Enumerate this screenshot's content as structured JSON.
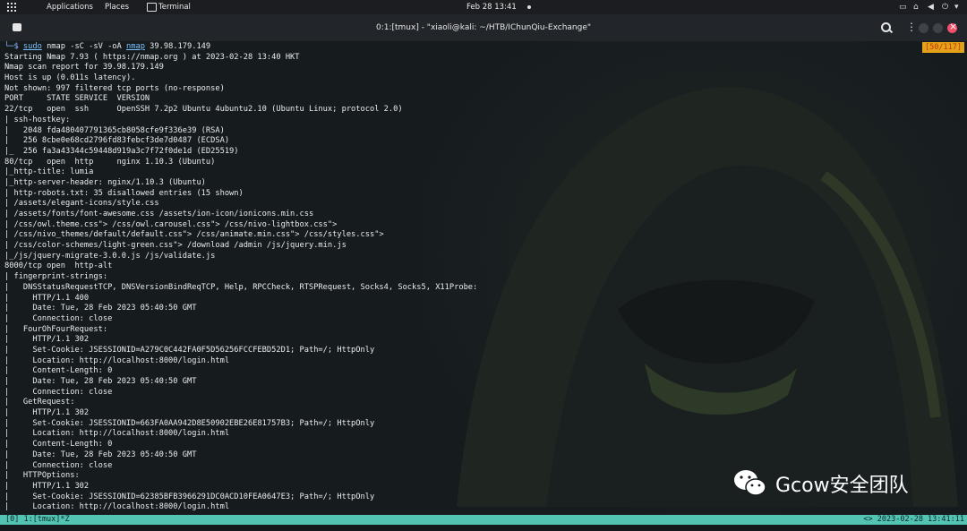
{
  "topbar": {
    "applications": "Applications",
    "places": "Places",
    "terminal": "Terminal",
    "clock": "Feb 28  13:41",
    "tray_icons": [
      "display-icon",
      "network-icon",
      "volume-icon",
      "power-icon"
    ]
  },
  "titlebar": {
    "title": "0:1:[tmux] - \"xiaoli@kali: ~/HTB/IChunQiu-Exchange\""
  },
  "terminal": {
    "counter": "[50/117]",
    "prompt": {
      "prefix": "└─$ ",
      "sudo": "sudo",
      "args": " nmap -sC -sV -oA ",
      "nmap": "nmap",
      "target": " 39.98.179.149"
    },
    "lines": [
      "Starting Nmap 7.93 ( https://nmap.org ) at 2023-02-28 13:40 HKT",
      "Nmap scan report for 39.98.179.149",
      "Host is up (0.011s latency).",
      "Not shown: 997 filtered tcp ports (no-response)",
      "PORT     STATE SERVICE  VERSION",
      "22/tcp   open  ssh      OpenSSH 7.2p2 Ubuntu 4ubuntu2.10 (Ubuntu Linux; protocol 2.0)",
      "| ssh-hostkey:",
      "|   2048 fda480407791365cb8058cfe9f336e39 (RSA)",
      "|   256 8cbe0e68cd2796fd83febcf3de7d0487 (ECDSA)",
      "|_  256 fa3a43344c59448d919a3c7f72f0de1d (ED25519)",
      "80/tcp   open  http     nginx 1.10.3 (Ubuntu)",
      "|_http-title: lumia",
      "|_http-server-header: nginx/1.10.3 (Ubuntu)",
      "| http-robots.txt: 35 disallowed entries (15 shown)",
      "| /assets/elegant-icons/style.css",
      "| /assets/fonts/font-awesome.css /assets/ion-icon/ionicons.min.css",
      "| /css/owl.theme.css\"> /css/owl.carousel.css\"> /css/nivo-lightbox.css\">",
      "| /css/nivo_themes/default/default.css\"> /css/animate.min.css\"> /css/styles.css\">",
      "| /css/color-schemes/light-green.css\"> /download /admin /js/jquery.min.js",
      "|_/js/jquery-migrate-3.0.0.js /js/validate.js",
      "8000/tcp open  http-alt",
      "| fingerprint-strings:",
      "|   DNSStatusRequestTCP, DNSVersionBindReqTCP, Help, RPCCheck, RTSPRequest, Socks4, Socks5, X11Probe:",
      "|     HTTP/1.1 400",
      "|     Date: Tue, 28 Feb 2023 05:40:50 GMT",
      "|     Connection: close",
      "|   FourOhFourRequest:",
      "|     HTTP/1.1 302",
      "|     Set-Cookie: JSESSIONID=A279C0C442FA0F5D56256FCCFEBD52D1; Path=/; HttpOnly",
      "|     Location: http://localhost:8000/login.html",
      "|     Content-Length: 0",
      "|     Date: Tue, 28 Feb 2023 05:40:50 GMT",
      "|     Connection: close",
      "|   GetRequest:",
      "|     HTTP/1.1 302",
      "|     Set-Cookie: JSESSIONID=663FA0AA942D8E50902EBE26E81757B3; Path=/; HttpOnly",
      "|     Location: http://localhost:8000/login.html",
      "|     Content-Length: 0",
      "|     Date: Tue, 28 Feb 2023 05:40:50 GMT",
      "|     Connection: close",
      "|   HTTPOptions:",
      "|     HTTP/1.1 302",
      "|     Set-Cookie: JSESSIONID=62385BFB3966291DC0ACD10FEA0647E3; Path=/; HttpOnly",
      "|     Location: http://localhost:8000/login.html"
    ],
    "watermark": "Gcow安全团队"
  },
  "statusbar": {
    "left": "[0] 1:[tmux]*Z",
    "right": "<> 2023-02-28 13:41:11"
  },
  "colors": {
    "terminal_bg": "#161b1e",
    "status_bar": "#53c4b4",
    "counter_bg": "#e3a21a",
    "close_button": "#ef4f6b"
  }
}
